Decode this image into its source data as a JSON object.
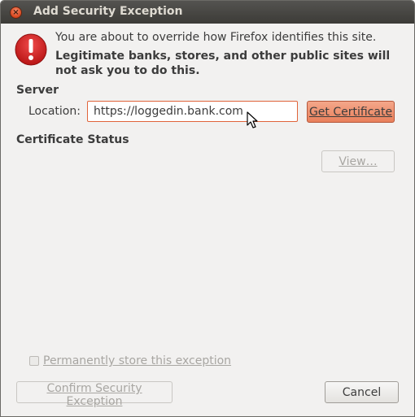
{
  "window": {
    "title": "Add Security Exception"
  },
  "message": {
    "line1": "You are about to override how Firefox identifies this site.",
    "line2": "Legitimate banks, stores, and other public sites will not ask you to do this."
  },
  "server": {
    "heading": "Server",
    "location_label": "Location:",
    "location_value": "https://loggedin.bank.com",
    "get_certificate_label": "Get Certificate"
  },
  "certificate_status": {
    "heading": "Certificate Status",
    "view_label": "View…"
  },
  "footer": {
    "permanent_label": "Permanently store this exception",
    "permanent_checked": false,
    "confirm_label": "Confirm Security Exception",
    "cancel_label": "Cancel"
  },
  "icons": {
    "close": "close-icon",
    "warning": "warning-icon",
    "cursor": "mouse-pointer-icon"
  },
  "colors": {
    "accent": "#e9805b",
    "warning_red": "#d21f1f",
    "titlebar": "#3c3b37"
  }
}
